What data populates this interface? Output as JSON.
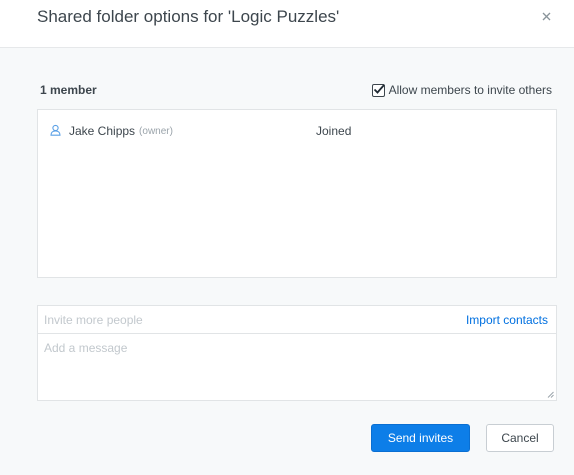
{
  "dialog": {
    "title": "Shared folder options for 'Logic Puzzles'",
    "close_icon": "close-icon"
  },
  "members": {
    "count_label": "1 member",
    "allow_invite_label": "Allow members to invite others",
    "allow_invite_checked": true,
    "list": [
      {
        "icon": "user-icon",
        "name": "Jake Chipps",
        "role": "(owner)",
        "status": "Joined"
      }
    ]
  },
  "invite": {
    "placeholder": "Invite more people",
    "import_label": "Import contacts",
    "message_placeholder": "Add a message"
  },
  "actions": {
    "send_label": "Send invites",
    "cancel_label": "Cancel"
  },
  "colors": {
    "accent": "#0d7ee8",
    "link": "#0070e0",
    "panel_bg": "#f7f9fa"
  }
}
